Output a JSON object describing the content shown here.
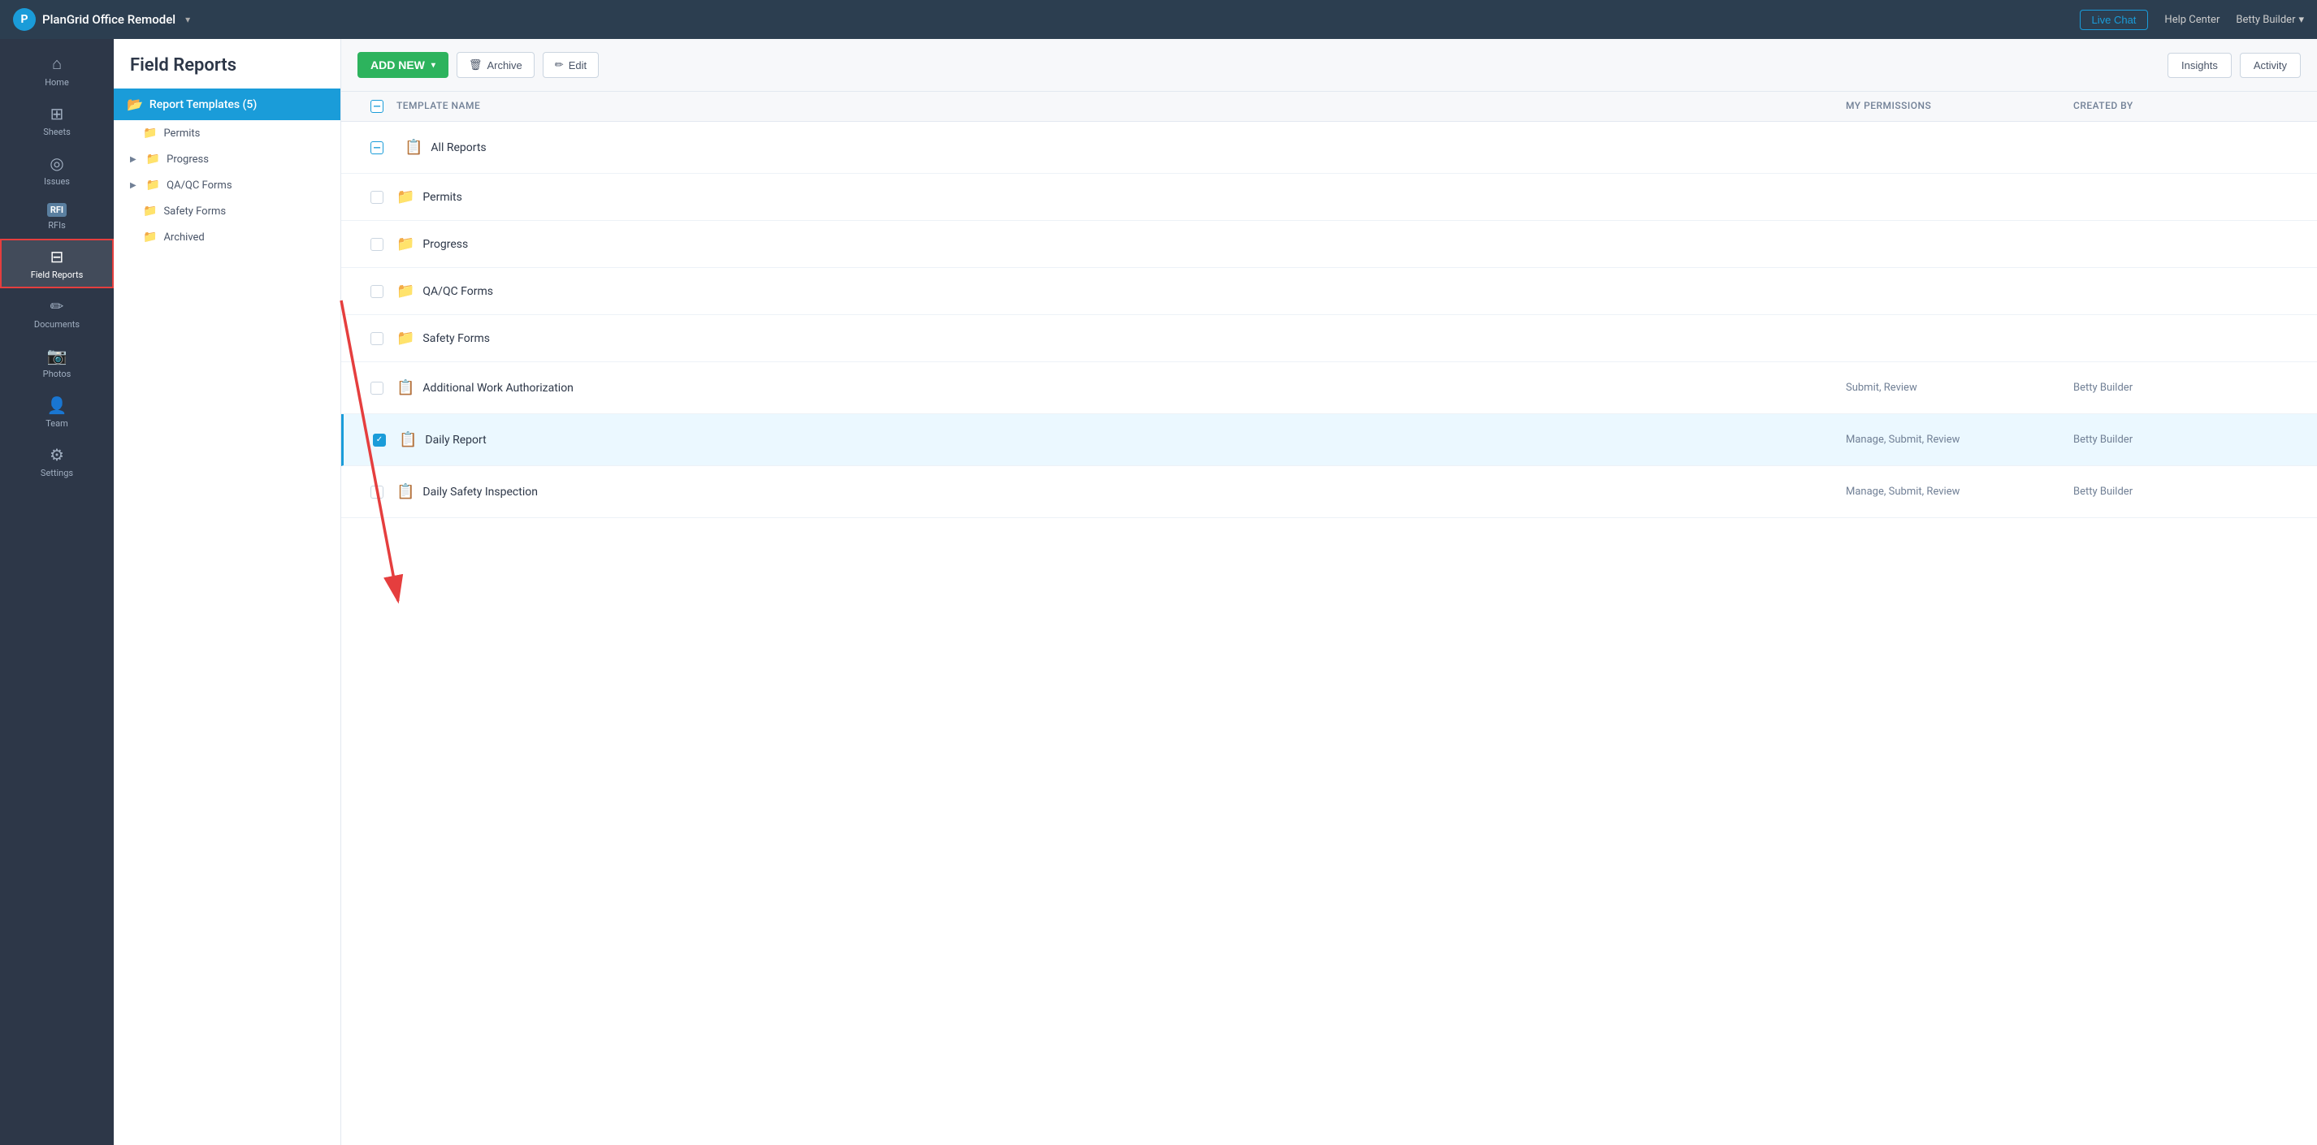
{
  "topbar": {
    "logo_text": "P",
    "project_name": "PlanGrid Office Remodel",
    "live_chat_label": "Live Chat",
    "help_center_label": "Help Center",
    "user_label": "Betty Builder",
    "dropdown_arrow": "▾"
  },
  "sidebar": {
    "items": [
      {
        "id": "home",
        "icon": "⌂",
        "label": "Home",
        "active": false
      },
      {
        "id": "sheets",
        "icon": "⊞",
        "label": "Sheets",
        "active": false
      },
      {
        "id": "issues",
        "icon": "◎",
        "label": "Issues",
        "active": false
      },
      {
        "id": "rfis",
        "icon": "RFI",
        "label": "RFIs",
        "active": false
      },
      {
        "id": "field-reports",
        "icon": "⊟",
        "label": "Field Reports",
        "active": true
      },
      {
        "id": "documents",
        "icon": "✏",
        "label": "Documents",
        "active": false
      },
      {
        "id": "photos",
        "icon": "📷",
        "label": "Photos",
        "active": false
      },
      {
        "id": "team",
        "icon": "👤",
        "label": "Team",
        "active": false
      },
      {
        "id": "settings",
        "icon": "⚙",
        "label": "Settings",
        "active": false
      }
    ]
  },
  "left_panel": {
    "title": "Field Reports",
    "selected_folder": {
      "label": "Report Templates (5)",
      "icon": "📁"
    },
    "tree_items": [
      {
        "label": "Permits",
        "has_arrow": false,
        "indent": true
      },
      {
        "label": "Progress",
        "has_arrow": true,
        "indent": false
      },
      {
        "label": "QA/QC Forms",
        "has_arrow": true,
        "indent": false
      },
      {
        "label": "Safety Forms",
        "has_arrow": false,
        "indent": true
      },
      {
        "label": "Archived",
        "has_arrow": false,
        "indent": true
      }
    ]
  },
  "toolbar": {
    "add_new_label": "ADD NEW",
    "add_new_arrow": "▾",
    "archive_label": "Archive",
    "edit_label": "Edit",
    "insights_label": "Insights",
    "activity_label": "Activity"
  },
  "table": {
    "columns": [
      {
        "id": "checkbox",
        "label": ""
      },
      {
        "id": "name",
        "label": "Template Name"
      },
      {
        "id": "permissions",
        "label": "My Permissions"
      },
      {
        "id": "created",
        "label": "Created By"
      }
    ],
    "rows": [
      {
        "id": "all-reports",
        "type": "special",
        "icon": "📋",
        "name": "All Reports",
        "permissions": "",
        "created": "",
        "checked": false,
        "indeterminate": true
      },
      {
        "id": "permits",
        "type": "folder",
        "icon": "📁",
        "name": "Permits",
        "permissions": "",
        "created": "",
        "checked": false
      },
      {
        "id": "progress",
        "type": "folder",
        "icon": "📁",
        "name": "Progress",
        "permissions": "",
        "created": "",
        "checked": false
      },
      {
        "id": "qa-qc-forms",
        "type": "folder",
        "icon": "📁",
        "name": "QA/QC Forms",
        "permissions": "",
        "created": "",
        "checked": false
      },
      {
        "id": "safety-forms",
        "type": "folder",
        "icon": "📁",
        "name": "Safety Forms",
        "permissions": "",
        "created": "",
        "checked": false
      },
      {
        "id": "additional-work-authorization",
        "type": "template",
        "icon": "📋",
        "name": "Additional Work Authorization",
        "permissions": "Submit, Review",
        "created": "Betty Builder",
        "checked": false
      },
      {
        "id": "daily-report",
        "type": "template",
        "icon": "📋",
        "name": "Daily Report",
        "permissions": "Manage, Submit, Review",
        "created": "Betty Builder",
        "checked": true,
        "selected": true
      },
      {
        "id": "daily-safety-inspection",
        "type": "template",
        "icon": "📋",
        "name": "Daily Safety Inspection",
        "permissions": "Manage, Submit, Review",
        "created": "Betty Builder",
        "checked": false
      }
    ]
  },
  "annotation": {
    "arrow_source_label": "Safety Forms (left panel)",
    "arrow_target_label": "Daily Report (selected row)"
  },
  "colors": {
    "primary_blue": "#1a9cd9",
    "green": "#2db35d",
    "sidebar_bg": "#2d3748",
    "red_arrow": "#e53e3e",
    "selected_row_bg": "#ebf8ff"
  }
}
